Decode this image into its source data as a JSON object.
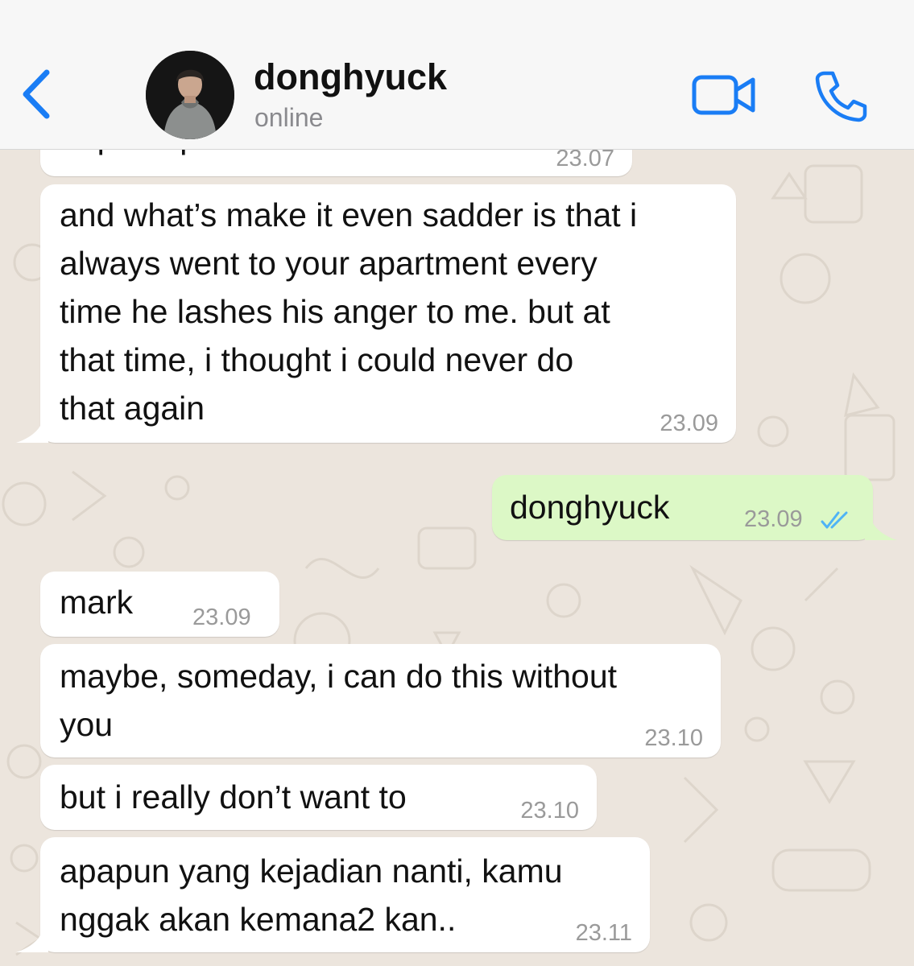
{
  "header": {
    "contact_name": "donghyuck",
    "status": "online",
    "accent_color": "#1a7df5"
  },
  "icons": {
    "back": "chevron-left-icon",
    "video": "video-camera-icon",
    "call": "phone-icon"
  },
  "messages": [
    {
      "direction": "incoming",
      "lines": [
        "depan apartemen kamu"
      ],
      "time": "23.07"
    },
    {
      "direction": "incoming",
      "lines": [
        "and what’s make it even sadder is that i",
        "always went to your apartment every",
        "time he lashes his anger to me. but at",
        "that time, i thought i could never do",
        "that again"
      ],
      "time": "23.09"
    },
    {
      "direction": "outgoing",
      "lines": [
        "donghyuck"
      ],
      "time": "23.09",
      "read": true
    },
    {
      "direction": "incoming",
      "lines": [
        "mark"
      ],
      "time": "23.09"
    },
    {
      "direction": "incoming",
      "lines": [
        "maybe, someday, i can do this without",
        "you"
      ],
      "time": "23.10"
    },
    {
      "direction": "incoming",
      "lines": [
        "but i really don’t want to"
      ],
      "time": "23.10"
    },
    {
      "direction": "incoming",
      "lines": [
        "apapun yang kejadian nanti, kamu",
        "nggak akan kemana2 kan.."
      ],
      "time": "23.11"
    }
  ]
}
